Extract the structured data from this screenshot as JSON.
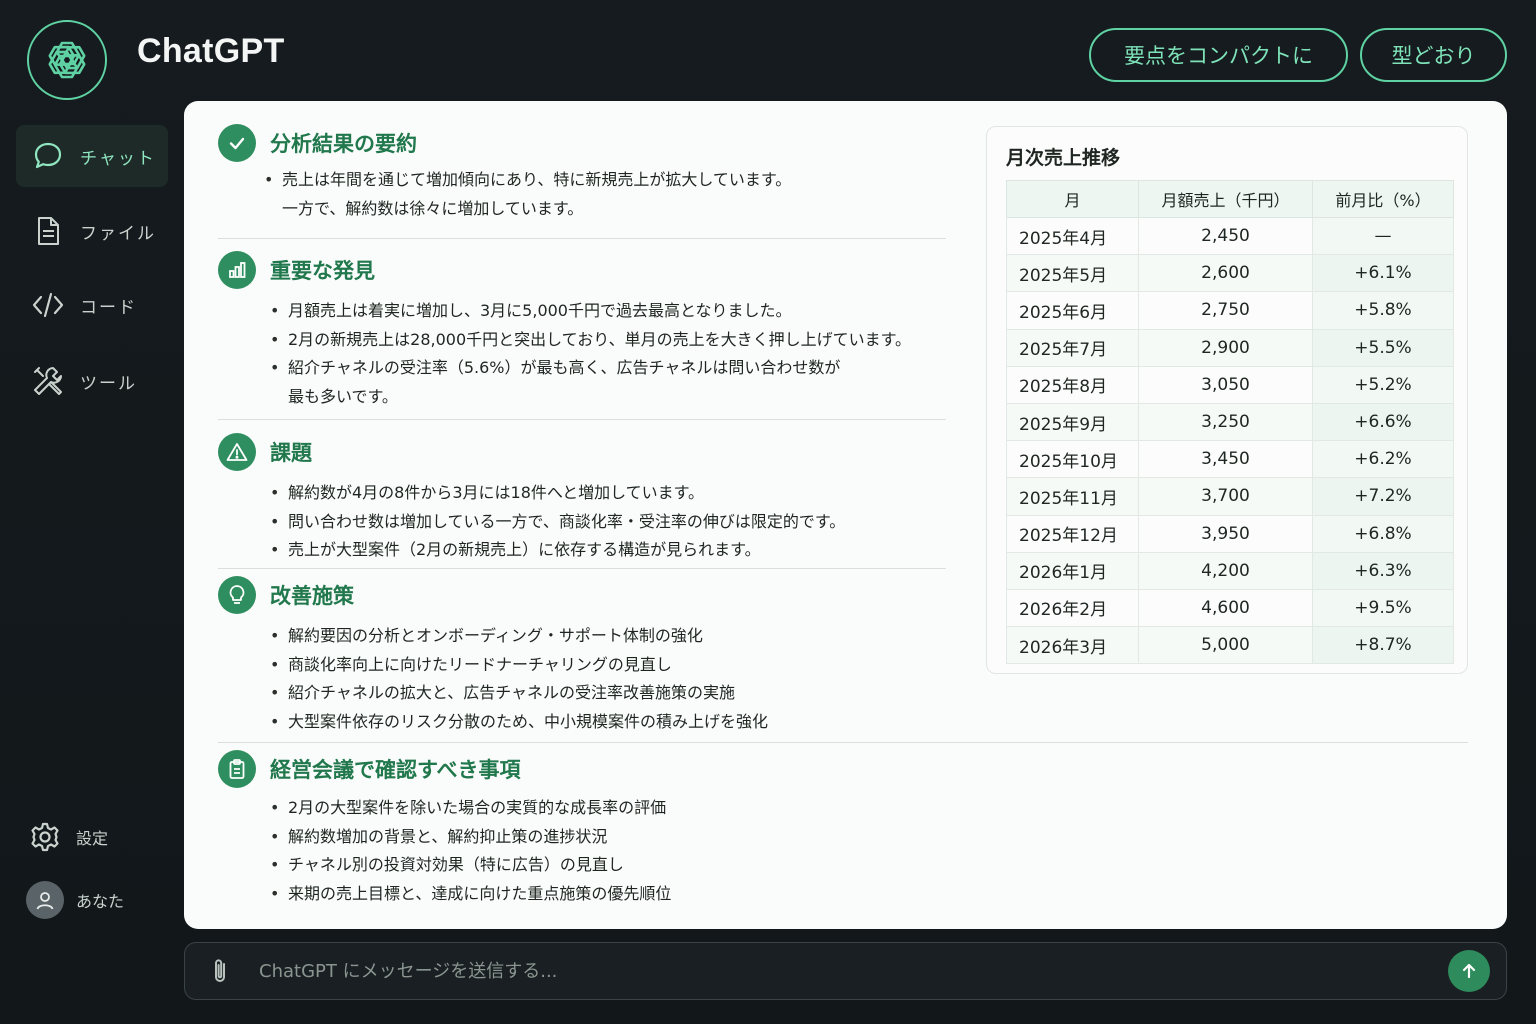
{
  "app": {
    "title": "ChatGPT"
  },
  "header": {
    "compact_label": "要点をコンパクトに",
    "format_label": "型どおり"
  },
  "sidebar": {
    "items": [
      {
        "label": "チャット",
        "icon": "chat-bubble-icon",
        "active": true
      },
      {
        "label": "ファイル",
        "icon": "file-icon"
      },
      {
        "label": "コード",
        "icon": "code-icon"
      },
      {
        "label": "ツール",
        "icon": "tools-icon"
      }
    ],
    "settings_label": "設定",
    "user_label": "あなた"
  },
  "sections": {
    "summary": {
      "title": "分析結果の要約",
      "bullets": [
        {
          "line1": "売上は年間を通じて増加傾向にあり、特に新規売上が拡大しています。",
          "line2": "一方で、解約数は徐々に増加しています。"
        }
      ]
    },
    "findings": {
      "title": "重要な発見",
      "bullets": [
        "月額売上は着実に増加し、3月に5,000千円で過去最高となりました。",
        "2月の新規売上は28,000千円と突出しており、単月の売上を大きく押し上げています。",
        {
          "line1": "紹介チャネルの受注率（5.6%）が最も高く、広告チャネルは問い合わせ数が",
          "line2": "最も多いです。"
        }
      ]
    },
    "issues": {
      "title": "課題",
      "bullets": [
        "解約数が4月の8件から3月には18件へと増加しています。",
        "問い合わせ数は増加している一方で、商談化率・受注率の伸びは限定的です。",
        "売上が大型案件（2月の新規売上）に依存する構造が見られます。"
      ]
    },
    "measures": {
      "title": "改善施策",
      "bullets": [
        "解約要因の分析とオンボーディング・サポート体制の強化",
        "商談化率向上に向けたリードナーチャリングの見直し",
        "紹介チャネルの拡大と、広告チャネルの受注率改善施策の実施",
        "大型案件依存のリスク分散のため、中小規模案件の積み上げを強化"
      ]
    },
    "meeting": {
      "title": "経営会議で確認すべき事項",
      "bullets": [
        "2月の大型案件を除いた場合の実質的な成長率の評価",
        "解約数増加の背景と、解約抑止策の進捗状況",
        "チャネル別の投資対効果（特に広告）の見直し",
        "来期の売上目標と、達成に向けた重点施策の優先順位"
      ]
    }
  },
  "table": {
    "title": "月次売上推移",
    "headers": [
      "月",
      "月額売上（千円）",
      "前月比（%）"
    ],
    "rows": [
      [
        "2025年4月",
        "2,450",
        "—"
      ],
      [
        "2025年5月",
        "2,600",
        "+6.1%"
      ],
      [
        "2025年6月",
        "2,750",
        "+5.8%"
      ],
      [
        "2025年7月",
        "2,900",
        "+5.5%"
      ],
      [
        "2025年8月",
        "3,050",
        "+5.2%"
      ],
      [
        "2025年9月",
        "3,250",
        "+6.6%"
      ],
      [
        "2025年10月",
        "3,450",
        "+6.2%"
      ],
      [
        "2025年11月",
        "3,700",
        "+7.2%"
      ],
      [
        "2025年12月",
        "3,950",
        "+6.8%"
      ],
      [
        "2026年1月",
        "4,200",
        "+6.3%"
      ],
      [
        "2026年2月",
        "4,600",
        "+9.5%"
      ],
      [
        "2026年3月",
        "5,000",
        "+8.7%"
      ]
    ]
  },
  "input": {
    "placeholder": "ChatGPT にメッセージを送信する..."
  },
  "colors": {
    "accent": "#5fd2a3",
    "section_title": "#22784d",
    "send_button": "#2e8b5b"
  }
}
